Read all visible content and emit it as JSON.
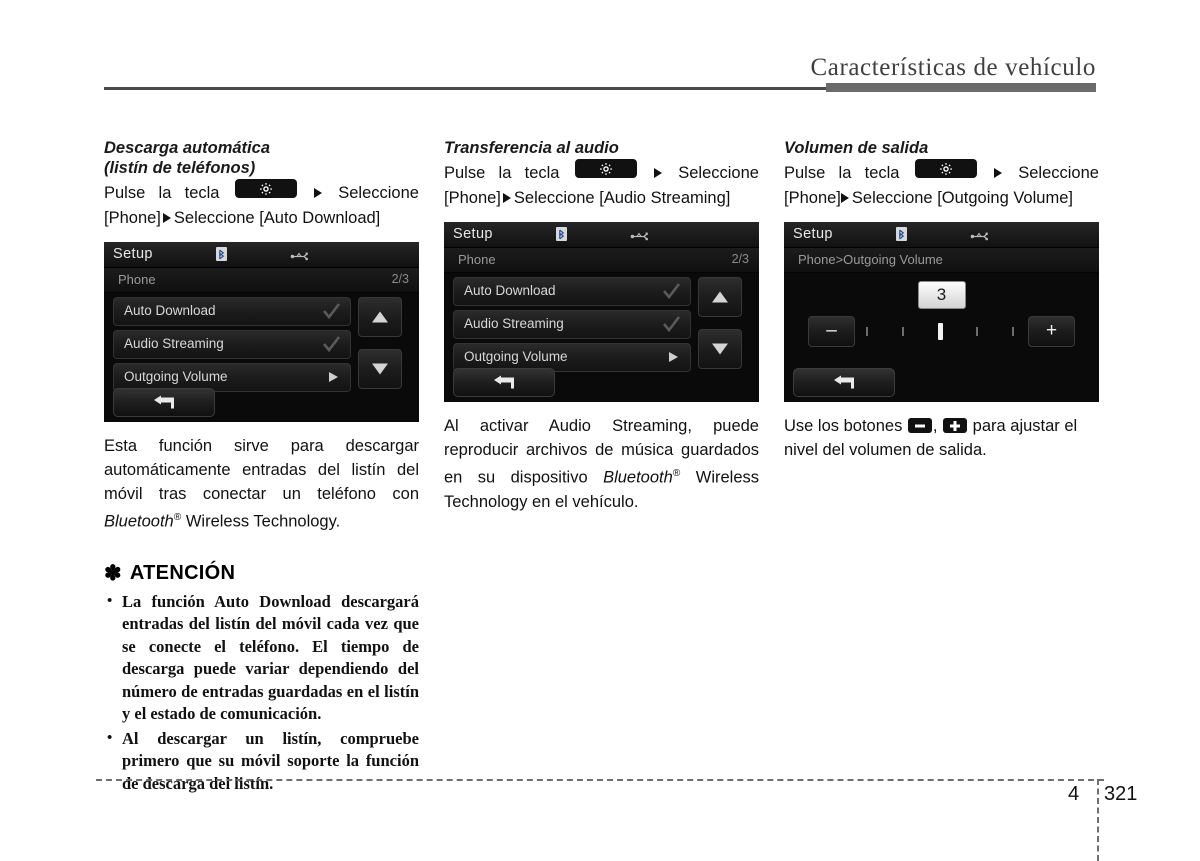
{
  "header": {
    "title": "Características de vehículo"
  },
  "columns": [
    {
      "title_lines": [
        "Descarga automática",
        "(listín de teléfonos)"
      ],
      "instruction": {
        "line1_pre": "Pulse",
        "line1_a": "la",
        "line1_b": "tecla",
        "key_icon": "gear-icon",
        "line1_post": "Seleccione",
        "line2_pre": "[Phone]",
        "line2_post": "Seleccione [Auto Download]"
      },
      "screen": {
        "title": "Setup",
        "status_icons": [
          "bluetooth-icon",
          "usb-icon"
        ],
        "sub_label": "Phone",
        "page_indicator": "2/3",
        "rows": [
          {
            "label": "Auto Download",
            "control": "check"
          },
          {
            "label": "Audio Streaming",
            "control": "check"
          },
          {
            "label": "Outgoing Volume",
            "control": "arrow"
          }
        ],
        "scroll_up": "▲",
        "scroll_down": "▼",
        "back": "back-icon"
      },
      "body": "Esta función sirve para descargar automáticamente entradas del listín del móvil tras conectar un teléfono con ",
      "body_italic": "Bluetooth",
      "body_sup": "®",
      "body_tail": " Wireless Technology."
    },
    {
      "title_lines": [
        "Transferencia al audio"
      ],
      "instruction": {
        "line1_pre": "Pulse",
        "line1_a": "la",
        "line1_b": "tecla",
        "key_icon": "gear-icon",
        "line1_post": "Seleccione",
        "line2_pre": "[Phone]",
        "line2_post": "Seleccione [Audio Streaming]"
      },
      "screen": {
        "title": "Setup",
        "status_icons": [
          "bluetooth-icon",
          "usb-icon"
        ],
        "sub_label": "Phone",
        "page_indicator": "2/3",
        "rows": [
          {
            "label": "Auto Download",
            "control": "check"
          },
          {
            "label": "Audio Streaming",
            "control": "check"
          },
          {
            "label": "Outgoing Volume",
            "control": "arrow"
          }
        ],
        "scroll_up": "▲",
        "scroll_down": "▼",
        "back": "back-icon"
      },
      "body": "Al activar Audio Streaming, puede reproducir archivos de música guardados en su dispositivo ",
      "body_italic": "Bluetooth",
      "body_sup": "®",
      "body_tail": " Wireless Technology en el vehículo."
    },
    {
      "title_lines": [
        "Volumen de salida"
      ],
      "instruction": {
        "line1_pre": "Pulse",
        "line1_a": "la",
        "line1_b": "tecla",
        "key_icon": "gear-icon",
        "line1_post": "Seleccione",
        "line2_pre": "[Phone]",
        "line2_post": "Seleccione [Outgoing Volume]"
      },
      "screen": {
        "title": "Setup",
        "status_icons": [
          "bluetooth-icon",
          "usb-icon"
        ],
        "breadcrumb": "Phone>Outgoing Volume",
        "volume_value": "3",
        "minus_label": "–",
        "plus_label": "+",
        "tick_count": 5,
        "active_tick": 3,
        "back": "back-icon"
      },
      "body_pre": "Use los botones ",
      "body_mid": ", ",
      "body_tail": " para ajustar el nivel del volumen de salida."
    }
  ],
  "caution": {
    "asterisk": "✽",
    "heading": "ATENCIÓN",
    "items": [
      "La función Auto Download descargará entradas del listín del móvil cada vez que se conecte el teléfono. El tiempo de descarga puede variar dependiendo del número de entradas guardadas en el listín y el estado de comunicación.",
      "Al descargar un listín, compruebe primero que su móvil soporte la función de descarga del listín."
    ]
  },
  "footer": {
    "chapter": "4",
    "page": "321"
  }
}
